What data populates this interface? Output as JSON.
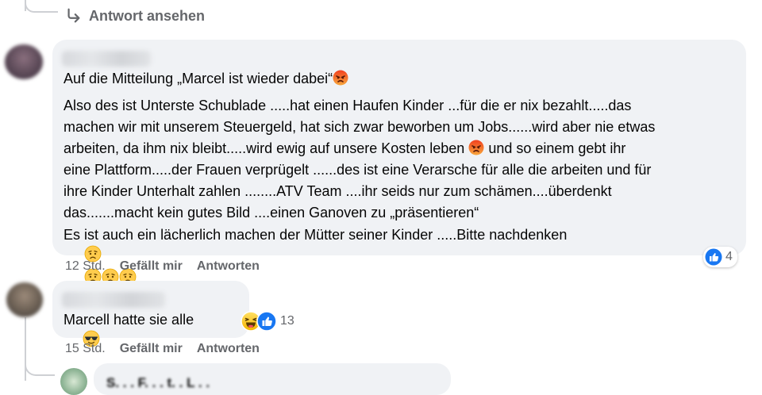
{
  "reply_link": {
    "label": "Antwort ansehen",
    "icon": "reply-arrow-icon"
  },
  "comments": [
    {
      "lines": [
        "Auf die Mitteilung „Marcel ist wieder dabei“",
        "Also des ist Unterste Schublade .....hat einen Haufen Kinder ...für die er nix bezahlt.....das",
        "machen wir mit unserem Steuergeld, hat sich zwar beworben um Jobs......wird aber nie etwas",
        "arbeiten, da ihm nix bleibt.....wird ewig auf unsere Kosten leben",
        " und so einem gebt ihr",
        "eine Plattform.....der Frauen verprügelt ......des ist eine Verarsche für alle die arbeiten und für",
        "ihre Kinder Unterhalt zahlen ........ATV Team ....ihr seids nur zum schämen....überdenkt",
        "das.......macht kein gutes Bild ....einen Ganoven zu „präsentieren“",
        "Es ist auch ein lächerlich machen der Mütter seiner Kinder .....Bitte nachdenken"
      ],
      "time": "12 Std.",
      "like_label": "Gefällt mir",
      "reply_label": "Antworten",
      "reaction_count": "4",
      "reaction_icons": [
        "like-icon"
      ]
    },
    {
      "lines": [
        "Marcell hatte sie alle"
      ],
      "time": "15 Std.",
      "like_label": "Gefällt mir",
      "reply_label": "Antworten",
      "reaction_count": "13",
      "reaction_icons": [
        "haha-icon",
        "like-icon"
      ]
    }
  ],
  "partial_reply": {
    "author": "S. . . F. . . t. . L . ."
  },
  "colors": {
    "bubble": "#f0f2f5",
    "meta": "#65676b",
    "like_blue": "#1877f2",
    "angry": "#e9710f"
  }
}
